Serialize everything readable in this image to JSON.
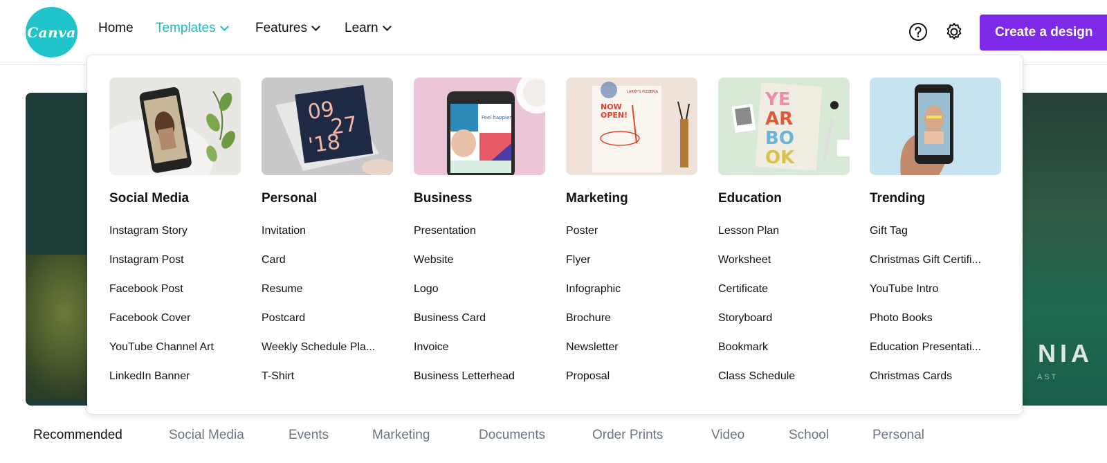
{
  "logo": {
    "text": "Canva"
  },
  "nav": [
    {
      "label": "Home",
      "active": false,
      "has_caret": false
    },
    {
      "label": "Templates",
      "active": true,
      "has_caret": true
    },
    {
      "label": "Features",
      "active": false,
      "has_caret": true
    },
    {
      "label": "Learn",
      "active": false,
      "has_caret": true
    }
  ],
  "header_icons": [
    "help-icon",
    "settings-icon"
  ],
  "create_button": {
    "label": "Create a design"
  },
  "hero": {
    "text": "NIA",
    "subtext": "AST"
  },
  "dropdown": {
    "columns": [
      {
        "title": "Social Media",
        "items": [
          "Instagram Story",
          "Instagram Post",
          "Facebook Post",
          "Facebook Cover",
          "YouTube Channel Art",
          "LinkedIn Banner"
        ]
      },
      {
        "title": "Personal",
        "items": [
          "Invitation",
          "Card",
          "Resume",
          "Postcard",
          "Weekly Schedule Pla...",
          "T-Shirt"
        ]
      },
      {
        "title": "Business",
        "items": [
          "Presentation",
          "Website",
          "Logo",
          "Business Card",
          "Invoice",
          "Business Letterhead"
        ]
      },
      {
        "title": "Marketing",
        "items": [
          "Poster",
          "Flyer",
          "Infographic",
          "Brochure",
          "Newsletter",
          "Proposal"
        ]
      },
      {
        "title": "Education",
        "items": [
          "Lesson Plan",
          "Worksheet",
          "Certificate",
          "Storyboard",
          "Bookmark",
          "Class Schedule"
        ]
      },
      {
        "title": "Trending",
        "items": [
          "Gift Tag",
          "Christmas Gift Certifi...",
          "YouTube Intro",
          "Photo Books",
          "Education Presentati...",
          "Christmas Cards"
        ]
      }
    ],
    "thumb_text": {
      "personal_line1": "09",
      "personal_line2": "27",
      "personal_line3": "'18",
      "business_phone": "Feel happier.",
      "marketing_now": "NOW",
      "marketing_open": "OPEN!",
      "marketing_brand": "LARRY'S PIZZERIA",
      "yearbook": [
        "YE",
        "AR",
        "BO",
        "OK"
      ]
    }
  },
  "categories": [
    {
      "label": "Recommended",
      "active": true
    },
    {
      "label": "Social Media",
      "active": false
    },
    {
      "label": "Events",
      "active": false
    },
    {
      "label": "Marketing",
      "active": false
    },
    {
      "label": "Documents",
      "active": false
    },
    {
      "label": "Order Prints",
      "active": false
    },
    {
      "label": "Video",
      "active": false
    },
    {
      "label": "School",
      "active": false
    },
    {
      "label": "Personal",
      "active": false
    }
  ],
  "colors": {
    "brand_teal": "#20c4cb",
    "nav_active": "#20b8c6",
    "create_button": "#7d2ae8"
  }
}
